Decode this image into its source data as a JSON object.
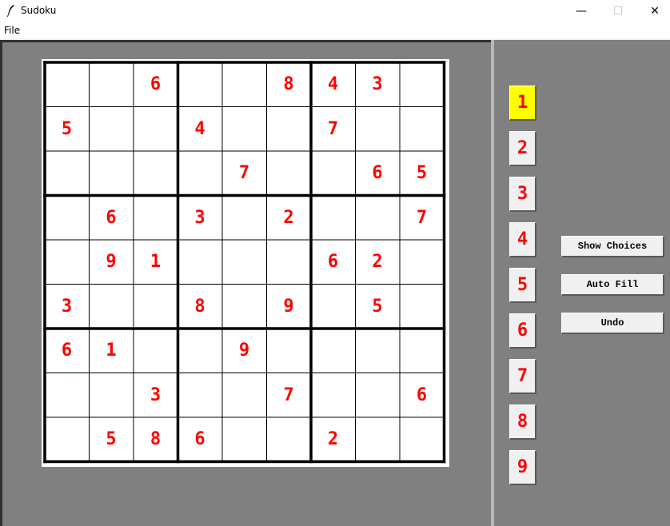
{
  "window": {
    "title": "Sudoku",
    "minimize_glyph": "—",
    "maximize_glyph": "☐",
    "close_glyph": "✕"
  },
  "menu": {
    "items": [
      "File"
    ]
  },
  "board": {
    "rows": [
      [
        "",
        "",
        "6",
        "",
        "",
        "8",
        "4",
        "3",
        ""
      ],
      [
        "5",
        "",
        "",
        "4",
        "",
        "",
        "7",
        "",
        ""
      ],
      [
        "",
        "",
        "",
        "",
        "7",
        "",
        "",
        "6",
        "5"
      ],
      [
        "",
        "6",
        "",
        "3",
        "",
        "2",
        "",
        "",
        "7"
      ],
      [
        "",
        "9",
        "1",
        "",
        "",
        "",
        "6",
        "2",
        ""
      ],
      [
        "3",
        "",
        "",
        "8",
        "",
        "9",
        "",
        "5",
        ""
      ],
      [
        "6",
        "1",
        "",
        "",
        "9",
        "",
        "",
        "",
        ""
      ],
      [
        "",
        "",
        "3",
        "",
        "",
        "7",
        "",
        "",
        "6"
      ],
      [
        "",
        "5",
        "8",
        "6",
        "",
        "",
        "2",
        "",
        ""
      ]
    ],
    "digit_color": "#ff0000"
  },
  "number_buttons": {
    "labels": [
      "1",
      "2",
      "3",
      "4",
      "5",
      "6",
      "7",
      "8",
      "9"
    ],
    "selected": "1",
    "selected_color": "#ffff00"
  },
  "actions": {
    "show_choices": "Show Choices",
    "auto_fill": "Auto Fill",
    "undo": "Undo"
  },
  "colors": {
    "pane_background": "#808080",
    "board_background": "#ffffff"
  }
}
